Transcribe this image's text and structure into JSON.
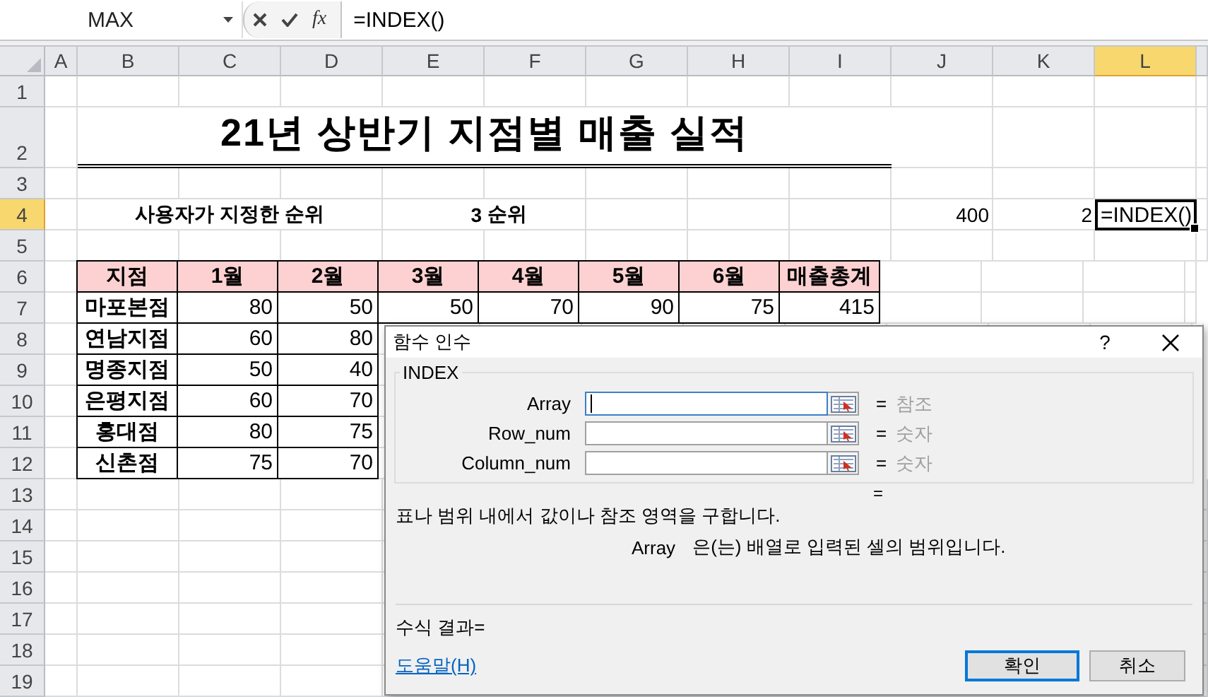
{
  "formula_bar": {
    "name_box": "MAX",
    "function_button": "fx",
    "formula": "=INDEX()"
  },
  "columns": [
    {
      "label": "A",
      "selected": false
    },
    {
      "label": "B",
      "selected": false
    },
    {
      "label": "C",
      "selected": false
    },
    {
      "label": "D",
      "selected": false
    },
    {
      "label": "E",
      "selected": false
    },
    {
      "label": "F",
      "selected": false
    },
    {
      "label": "G",
      "selected": false
    },
    {
      "label": "H",
      "selected": false
    },
    {
      "label": "I",
      "selected": false
    },
    {
      "label": "J",
      "selected": false
    },
    {
      "label": "K",
      "selected": false
    },
    {
      "label": "L",
      "selected": true
    }
  ],
  "rows": [
    {
      "kind": "blank",
      "number": "1",
      "selected": false
    },
    {
      "kind": "title",
      "number": "2",
      "selected": false,
      "text": "21년 상반기 지점별 매출 실적"
    },
    {
      "kind": "blank",
      "number": "3",
      "selected": false
    },
    {
      "kind": "info",
      "number": "4",
      "selected": true,
      "label": "사용자가 지정한 순위",
      "value": "3",
      "unit": "순위",
      "cell_j": "400",
      "cell_k": "2",
      "active_cell": "=INDEX()"
    },
    {
      "kind": "blank",
      "number": "5",
      "selected": false
    },
    {
      "kind": "header",
      "number": "6",
      "selected": false,
      "cells": [
        "지점",
        "1월",
        "2월",
        "3월",
        "4월",
        "5월",
        "6월",
        "매출총계"
      ]
    },
    {
      "kind": "data",
      "number": "7",
      "selected": false,
      "cells": [
        "마포본점",
        "80",
        "50",
        "50",
        "70",
        "90",
        "75",
        "415"
      ]
    },
    {
      "kind": "data",
      "number": "8",
      "selected": false,
      "cells": [
        "연남지점",
        "60",
        "80"
      ]
    },
    {
      "kind": "data",
      "number": "9",
      "selected": false,
      "cells": [
        "명종지점",
        "50",
        "40"
      ]
    },
    {
      "kind": "data",
      "number": "10",
      "selected": false,
      "cells": [
        "은평지점",
        "60",
        "70"
      ]
    },
    {
      "kind": "data",
      "number": "11",
      "selected": false,
      "cells": [
        "홍대점",
        "80",
        "75"
      ]
    },
    {
      "kind": "data",
      "number": "12",
      "selected": false,
      "cells": [
        "신촌점",
        "75",
        "70"
      ]
    },
    {
      "kind": "blank",
      "number": "13",
      "selected": false
    },
    {
      "kind": "blank",
      "number": "14",
      "selected": false
    },
    {
      "kind": "blank",
      "number": "15",
      "selected": false
    },
    {
      "kind": "blank",
      "number": "16",
      "selected": false
    },
    {
      "kind": "blank",
      "number": "17",
      "selected": false
    },
    {
      "kind": "blank",
      "number": "18",
      "selected": false
    },
    {
      "kind": "blank",
      "number": "19",
      "selected": false
    }
  ],
  "dialog": {
    "title": "함수 인수",
    "help_mark": "?",
    "function_name": "INDEX",
    "arguments": [
      {
        "name": "Array",
        "focused": true,
        "equals": "=",
        "hint": "참조"
      },
      {
        "name": "Row_num",
        "focused": false,
        "equals": "=",
        "hint": "숫자"
      },
      {
        "name": "Column_num",
        "focused": false,
        "equals": "=",
        "hint": "숫자"
      }
    ],
    "result_equals": "=",
    "description": "표나 범위 내에서 값이나 참조 영역을 구합니다.",
    "argument_name": "Array",
    "argument_description": "은(는) 배열로 입력된 셀의 범위입니다.",
    "formula_result": "수식 결과=",
    "help_link": "도움말(H)",
    "buttons": [
      {
        "label": "확인",
        "selected": true
      },
      {
        "label": "취소",
        "selected": false
      }
    ]
  }
}
